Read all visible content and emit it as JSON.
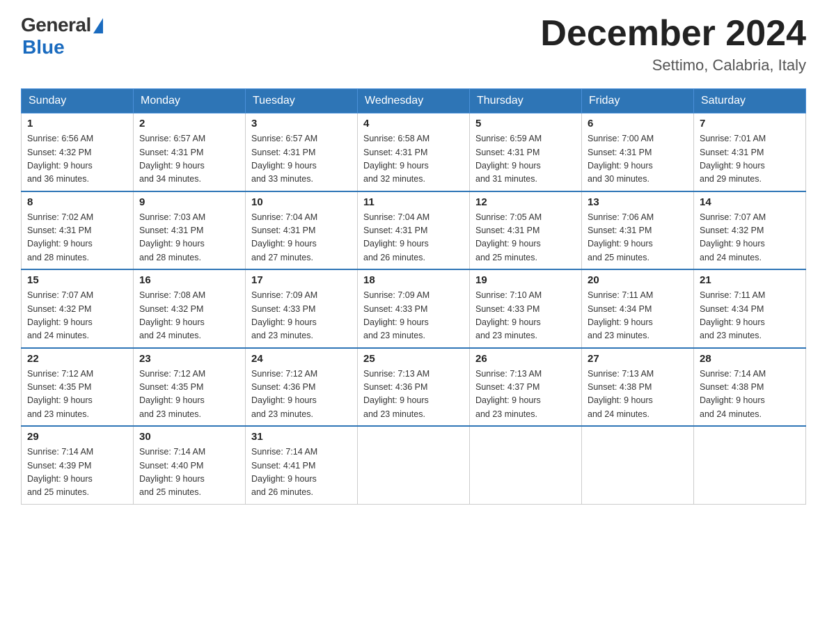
{
  "header": {
    "logo_general": "General",
    "logo_blue": "Blue",
    "month_title": "December 2024",
    "location": "Settimo, Calabria, Italy"
  },
  "days_of_week": [
    "Sunday",
    "Monday",
    "Tuesday",
    "Wednesday",
    "Thursday",
    "Friday",
    "Saturday"
  ],
  "weeks": [
    [
      {
        "day": "1",
        "sunrise": "6:56 AM",
        "sunset": "4:32 PM",
        "daylight": "9 hours and 36 minutes."
      },
      {
        "day": "2",
        "sunrise": "6:57 AM",
        "sunset": "4:31 PM",
        "daylight": "9 hours and 34 minutes."
      },
      {
        "day": "3",
        "sunrise": "6:57 AM",
        "sunset": "4:31 PM",
        "daylight": "9 hours and 33 minutes."
      },
      {
        "day": "4",
        "sunrise": "6:58 AM",
        "sunset": "4:31 PM",
        "daylight": "9 hours and 32 minutes."
      },
      {
        "day": "5",
        "sunrise": "6:59 AM",
        "sunset": "4:31 PM",
        "daylight": "9 hours and 31 minutes."
      },
      {
        "day": "6",
        "sunrise": "7:00 AM",
        "sunset": "4:31 PM",
        "daylight": "9 hours and 30 minutes."
      },
      {
        "day": "7",
        "sunrise": "7:01 AM",
        "sunset": "4:31 PM",
        "daylight": "9 hours and 29 minutes."
      }
    ],
    [
      {
        "day": "8",
        "sunrise": "7:02 AM",
        "sunset": "4:31 PM",
        "daylight": "9 hours and 28 minutes."
      },
      {
        "day": "9",
        "sunrise": "7:03 AM",
        "sunset": "4:31 PM",
        "daylight": "9 hours and 28 minutes."
      },
      {
        "day": "10",
        "sunrise": "7:04 AM",
        "sunset": "4:31 PM",
        "daylight": "9 hours and 27 minutes."
      },
      {
        "day": "11",
        "sunrise": "7:04 AM",
        "sunset": "4:31 PM",
        "daylight": "9 hours and 26 minutes."
      },
      {
        "day": "12",
        "sunrise": "7:05 AM",
        "sunset": "4:31 PM",
        "daylight": "9 hours and 25 minutes."
      },
      {
        "day": "13",
        "sunrise": "7:06 AM",
        "sunset": "4:31 PM",
        "daylight": "9 hours and 25 minutes."
      },
      {
        "day": "14",
        "sunrise": "7:07 AM",
        "sunset": "4:32 PM",
        "daylight": "9 hours and 24 minutes."
      }
    ],
    [
      {
        "day": "15",
        "sunrise": "7:07 AM",
        "sunset": "4:32 PM",
        "daylight": "9 hours and 24 minutes."
      },
      {
        "day": "16",
        "sunrise": "7:08 AM",
        "sunset": "4:32 PM",
        "daylight": "9 hours and 24 minutes."
      },
      {
        "day": "17",
        "sunrise": "7:09 AM",
        "sunset": "4:33 PM",
        "daylight": "9 hours and 23 minutes."
      },
      {
        "day": "18",
        "sunrise": "7:09 AM",
        "sunset": "4:33 PM",
        "daylight": "9 hours and 23 minutes."
      },
      {
        "day": "19",
        "sunrise": "7:10 AM",
        "sunset": "4:33 PM",
        "daylight": "9 hours and 23 minutes."
      },
      {
        "day": "20",
        "sunrise": "7:11 AM",
        "sunset": "4:34 PM",
        "daylight": "9 hours and 23 minutes."
      },
      {
        "day": "21",
        "sunrise": "7:11 AM",
        "sunset": "4:34 PM",
        "daylight": "9 hours and 23 minutes."
      }
    ],
    [
      {
        "day": "22",
        "sunrise": "7:12 AM",
        "sunset": "4:35 PM",
        "daylight": "9 hours and 23 minutes."
      },
      {
        "day": "23",
        "sunrise": "7:12 AM",
        "sunset": "4:35 PM",
        "daylight": "9 hours and 23 minutes."
      },
      {
        "day": "24",
        "sunrise": "7:12 AM",
        "sunset": "4:36 PM",
        "daylight": "9 hours and 23 minutes."
      },
      {
        "day": "25",
        "sunrise": "7:13 AM",
        "sunset": "4:36 PM",
        "daylight": "9 hours and 23 minutes."
      },
      {
        "day": "26",
        "sunrise": "7:13 AM",
        "sunset": "4:37 PM",
        "daylight": "9 hours and 23 minutes."
      },
      {
        "day": "27",
        "sunrise": "7:13 AM",
        "sunset": "4:38 PM",
        "daylight": "9 hours and 24 minutes."
      },
      {
        "day": "28",
        "sunrise": "7:14 AM",
        "sunset": "4:38 PM",
        "daylight": "9 hours and 24 minutes."
      }
    ],
    [
      {
        "day": "29",
        "sunrise": "7:14 AM",
        "sunset": "4:39 PM",
        "daylight": "9 hours and 25 minutes."
      },
      {
        "day": "30",
        "sunrise": "7:14 AM",
        "sunset": "4:40 PM",
        "daylight": "9 hours and 25 minutes."
      },
      {
        "day": "31",
        "sunrise": "7:14 AM",
        "sunset": "4:41 PM",
        "daylight": "9 hours and 26 minutes."
      },
      null,
      null,
      null,
      null
    ]
  ]
}
